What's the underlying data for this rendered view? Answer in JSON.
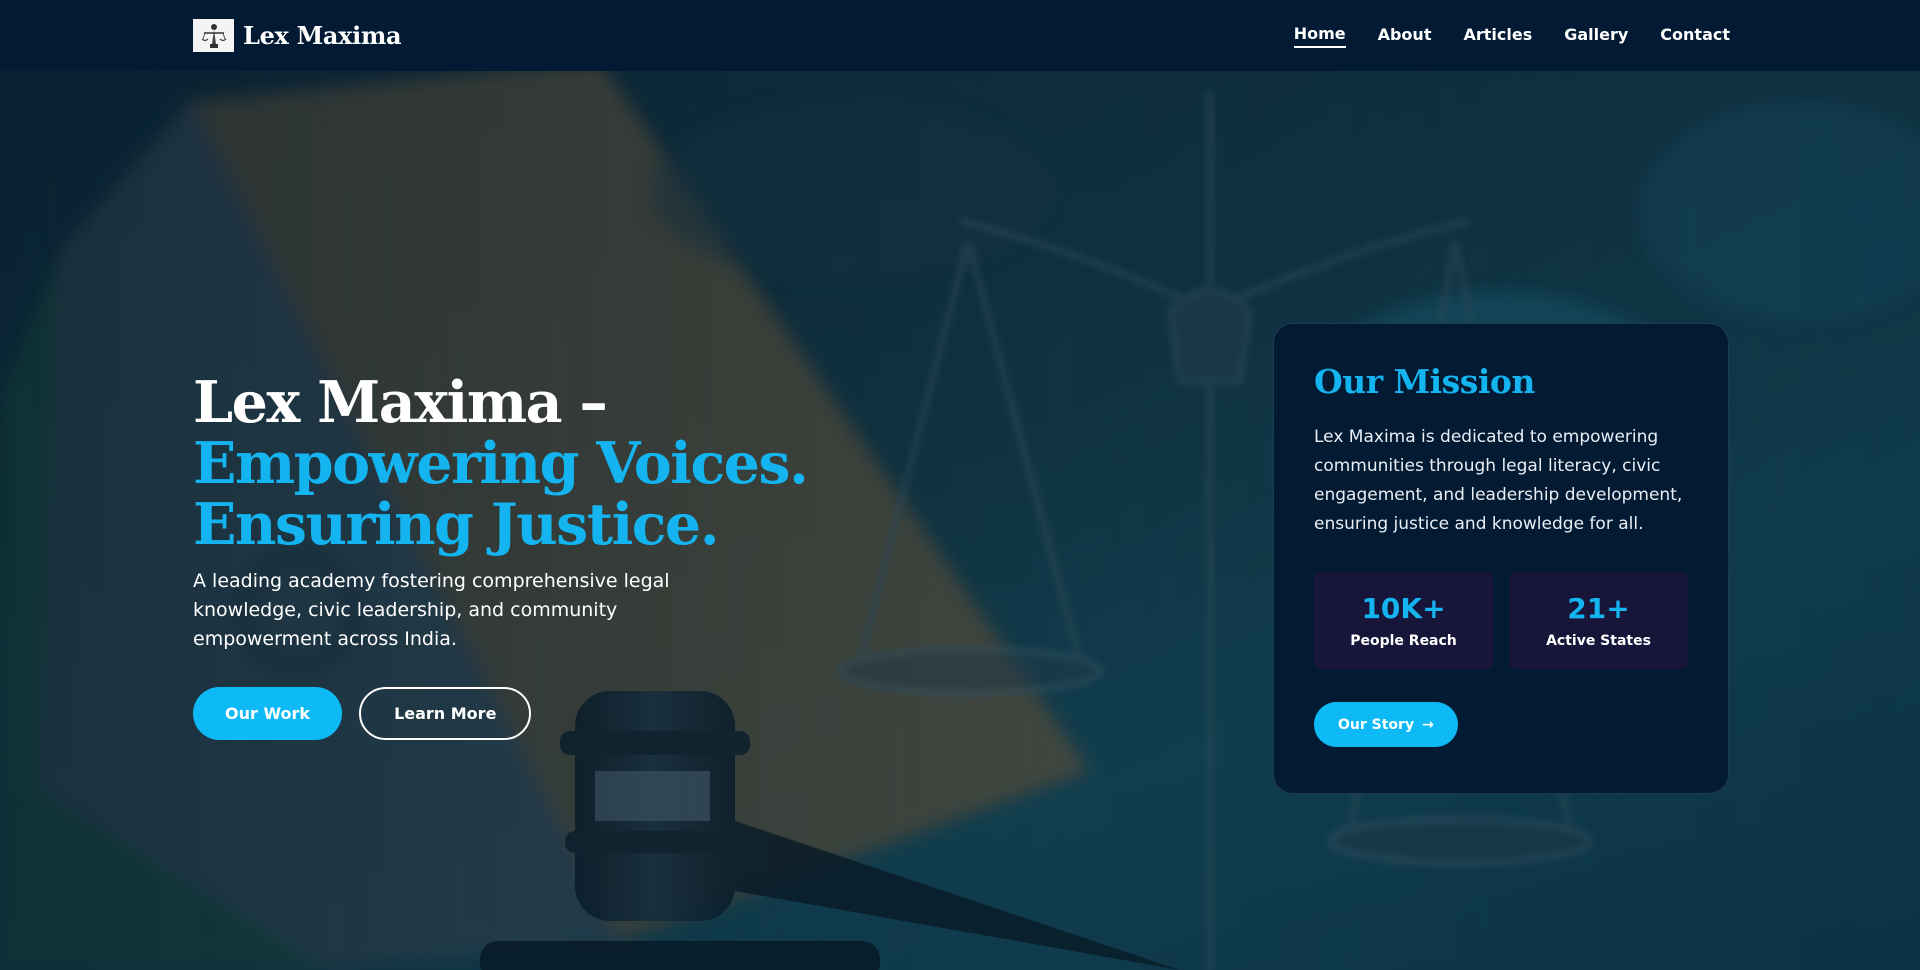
{
  "header": {
    "brand_name": "Lex Maxima",
    "nav": [
      {
        "label": "Home",
        "active": true
      },
      {
        "label": "About",
        "active": false
      },
      {
        "label": "Articles",
        "active": false
      },
      {
        "label": "Gallery",
        "active": false
      },
      {
        "label": "Contact",
        "active": false
      }
    ]
  },
  "hero": {
    "title_line1": "Lex Maxima –",
    "title_line2": "Empowering Voices.",
    "title_line3": "Ensuring Justice.",
    "description": "A leading academy fostering comprehensive legal knowledge, civic leadership, and community empowerment across India.",
    "primary_button": "Our Work",
    "secondary_button": "Learn More",
    "background_image": "scales-of-justice-gavel-indian-flag"
  },
  "mission": {
    "title": "Our Mission",
    "text": "Lex Maxima is dedicated to empowering communities through legal literacy, civic engagement, and leadership development, ensuring justice and knowledge for all.",
    "stats": [
      {
        "value": "10K+",
        "label": "People Reach"
      },
      {
        "value": "21+",
        "label": "Active States"
      }
    ],
    "button_label": "Our Story",
    "button_icon": "arrow-right-icon"
  },
  "colors": {
    "header_bg": "#021a33",
    "accent": "#14b4f0",
    "card_bg": "#031a33",
    "stat_bg": "#17163a"
  }
}
